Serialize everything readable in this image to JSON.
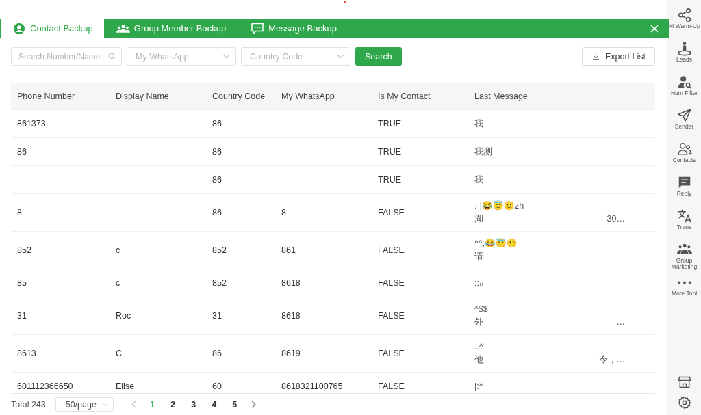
{
  "tabs": [
    {
      "label": "Contact Backup",
      "selected": true
    },
    {
      "label": "Group Member Backup",
      "selected": false
    },
    {
      "label": "Message Backup",
      "selected": false
    }
  ],
  "filters": {
    "search": {
      "placeholder": "Search Number/Name"
    },
    "whatsapp": {
      "placeholder": "My WhatsApp"
    },
    "country": {
      "placeholder": "Country Code"
    },
    "search_button": "Search",
    "export_button": "Export List"
  },
  "table": {
    "columns": [
      "Phone Number",
      "Display Name",
      "Country Code",
      "My WhatsApp",
      "Is My Contact",
      "Last Message"
    ],
    "rows": [
      {
        "phone": "861373",
        "name": "",
        "country": "86",
        "whatsapp": "",
        "contact": "TRUE",
        "message": [
          "我"
        ],
        "tail": ""
      },
      {
        "phone": "86",
        "name": "",
        "country": "86",
        "whatsapp": "",
        "contact": "TRUE",
        "message": [
          "我测"
        ],
        "tail": ""
      },
      {
        "phone": "",
        "name": "",
        "country": "86",
        "whatsapp": "",
        "contact": "TRUE",
        "message": [
          "我"
        ],
        "tail": ""
      },
      {
        "phone": "8",
        "name": "",
        "country": "86",
        "whatsapp": "8",
        "contact": "FALSE",
        "message": [
          ":-|😂😇🙂zh",
          "湖"
        ],
        "tail": "30…"
      },
      {
        "phone": "852",
        "name": "c",
        "country": "852",
        "whatsapp": "861",
        "contact": "FALSE",
        "message": [
          "^^,😂😇🙂",
          "请"
        ],
        "tail": ""
      },
      {
        "phone": "85",
        "name": "c",
        "country": "852",
        "whatsapp": "8618",
        "contact": "FALSE",
        "message": [
          ";;#"
        ],
        "tail": ""
      },
      {
        "phone": "31",
        "name": "Roc",
        "country": "31",
        "whatsapp": "8618",
        "contact": "FALSE",
        "message": [
          "^$$",
          "外"
        ],
        "tail": "…"
      },
      {
        "phone": "8613",
        "name": "C",
        "country": "86",
        "whatsapp": "8619",
        "contact": "FALSE",
        "message": [
          "..^",
          "他"
        ],
        "tail": "令，…"
      },
      {
        "phone": "601112366650",
        "name": "Elise",
        "country": "60",
        "whatsapp": "8618321100765",
        "contact": "FALSE",
        "message": [
          "|:^"
        ],
        "tail": ""
      }
    ]
  },
  "pagination": {
    "total": "Total 243",
    "page_size": "50/page",
    "pages": [
      {
        "label": "1",
        "selected": true
      },
      {
        "label": "2",
        "selected": false
      },
      {
        "label": "3",
        "selected": false
      },
      {
        "label": "4",
        "selected": false
      },
      {
        "label": "5",
        "selected": false
      }
    ]
  },
  "sidebar": {
    "items": [
      {
        "label": "AI Warm-Up"
      },
      {
        "label": "Leads"
      },
      {
        "label": "Num Filter"
      },
      {
        "label": "Sender"
      },
      {
        "label": "Contacts"
      },
      {
        "label": "Reply"
      },
      {
        "label": "Trans"
      },
      {
        "label": "Group Marketing"
      },
      {
        "label": "More Tool"
      }
    ]
  }
}
